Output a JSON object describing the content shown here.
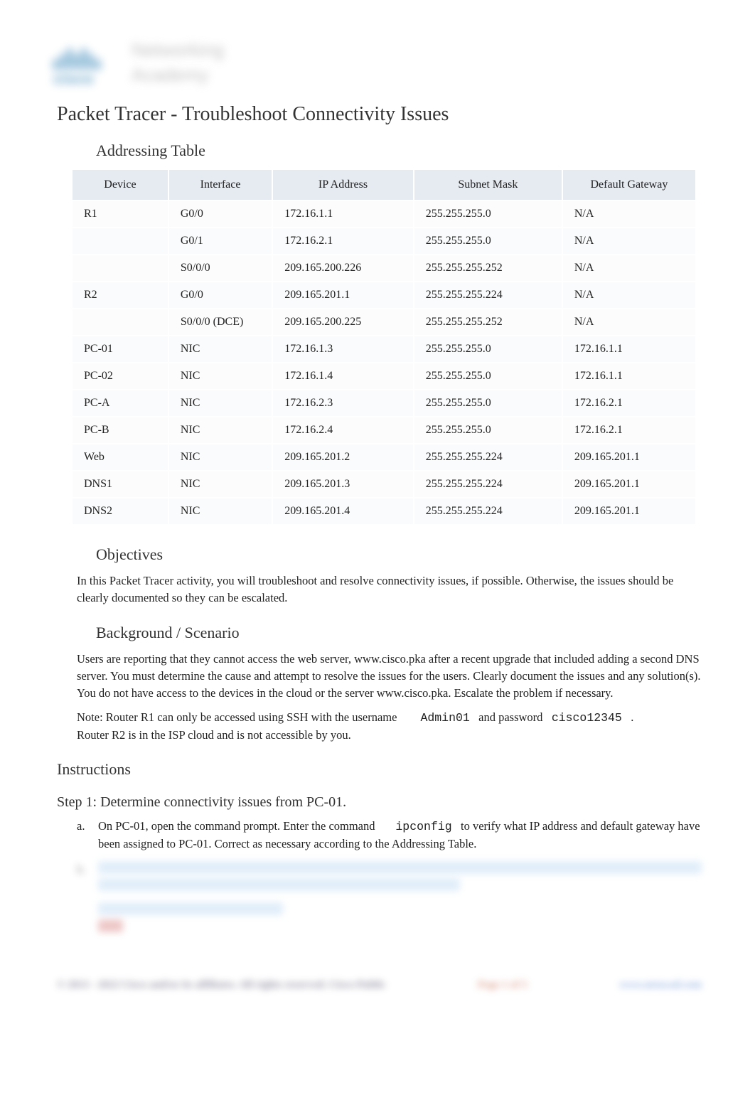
{
  "logo": {
    "brand": "cisco",
    "line1": "Networking",
    "line2": "Academy"
  },
  "title": "Packet Tracer - Troubleshoot Connectivity Issues",
  "sections": {
    "addressing_table": "Addressing Table",
    "objectives": "Objectives",
    "background": "Background / Scenario",
    "instructions": "Instructions"
  },
  "table": {
    "headers": {
      "device": "Device",
      "interface": "Interface",
      "ip": "IP Address",
      "mask": "Subnet Mask",
      "gateway": "Default Gateway"
    },
    "rows": [
      {
        "device": "R1",
        "interface": "G0/0",
        "ip": "172.16.1.1",
        "mask": "255.255.255.0",
        "gateway": "N/A"
      },
      {
        "device": "",
        "interface": "G0/1",
        "ip": "172.16.2.1",
        "mask": "255.255.255.0",
        "gateway": "N/A"
      },
      {
        "device": "",
        "interface": "S0/0/0",
        "ip": "209.165.200.226",
        "mask": "255.255.255.252",
        "gateway": "N/A"
      },
      {
        "device": "R2",
        "interface": "G0/0",
        "ip": "209.165.201.1",
        "mask": "255.255.255.224",
        "gateway": "N/A"
      },
      {
        "device": "",
        "interface": "S0/0/0 (DCE)",
        "ip": "209.165.200.225",
        "mask": "255.255.255.252",
        "gateway": "N/A"
      },
      {
        "device": "PC-01",
        "interface": "NIC",
        "ip": "172.16.1.3",
        "mask": "255.255.255.0",
        "gateway": "172.16.1.1"
      },
      {
        "device": "PC-02",
        "interface": "NIC",
        "ip": "172.16.1.4",
        "mask": "255.255.255.0",
        "gateway": "172.16.1.1"
      },
      {
        "device": "PC-A",
        "interface": "NIC",
        "ip": "172.16.2.3",
        "mask": "255.255.255.0",
        "gateway": "172.16.2.1"
      },
      {
        "device": "PC-B",
        "interface": "NIC",
        "ip": "172.16.2.4",
        "mask": "255.255.255.0",
        "gateway": "172.16.2.1"
      },
      {
        "device": "Web",
        "interface": "NIC",
        "ip": "209.165.201.2",
        "mask": "255.255.255.224",
        "gateway": "209.165.201.1"
      },
      {
        "device": "DNS1",
        "interface": "NIC",
        "ip": "209.165.201.3",
        "mask": "255.255.255.224",
        "gateway": "209.165.201.1"
      },
      {
        "device": "DNS2",
        "interface": "NIC",
        "ip": "209.165.201.4",
        "mask": "255.255.255.224",
        "gateway": "209.165.201.1"
      }
    ]
  },
  "objectives_text": "In this Packet Tracer activity, you will troubleshoot and resolve connectivity issues, if possible. Otherwise, the issues should be clearly documented so they can be escalated.",
  "background_text": "Users are reporting that they cannot access the web server, www.cisco.pka after a recent upgrade that included adding a second DNS server. You must determine the cause and attempt to resolve the issues for the users. Clearly document the issues and any solution(s). You do not have access to the devices in the cloud or the server www.cisco.pka. Escalate the problem if necessary.",
  "note": {
    "prefix": "Note:",
    "text1": "Router R1 can only be accessed using SSH with the username",
    "user": "Admin01",
    "text2": "and password",
    "pass": "cisco12345",
    "text3": ".",
    "line2": "Router R2 is in the ISP cloud and is not accessible by you."
  },
  "step1": {
    "heading": "Step 1: Determine connectivity issues from PC-01.",
    "a_marker": "a.",
    "a_pre": "On PC-01, open the command prompt. Enter the command",
    "a_cmd": "ipconfig",
    "a_post": "to verify what IP address and default gateway have been assigned to PC-01. Correct as necessary according to the Addressing Table.",
    "b_marker": "b."
  },
  "footer": {
    "left": "© 2013 - 2022 Cisco and/or its affiliates. All rights reserved. Cisco Public",
    "mid": "Page 1 of 5",
    "right": "www.netacad.com"
  }
}
